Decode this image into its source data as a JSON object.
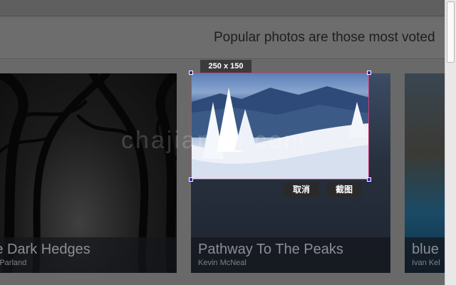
{
  "headline": "Popular photos are those most voted",
  "watermark": "chajianxw.com",
  "photos": [
    {
      "title": "The Dark Hedges",
      "author": "by McParland"
    },
    {
      "title": "Pathway To The Peaks",
      "author": "Kevin McNeal"
    },
    {
      "title": "blue",
      "author": "Ivan Kel"
    }
  ],
  "capture": {
    "size_label": "250 x 150",
    "cancel_label": "取消",
    "capture_label": "截图",
    "border_color": "#c7407a",
    "handle_color": "#2a2aa8"
  }
}
